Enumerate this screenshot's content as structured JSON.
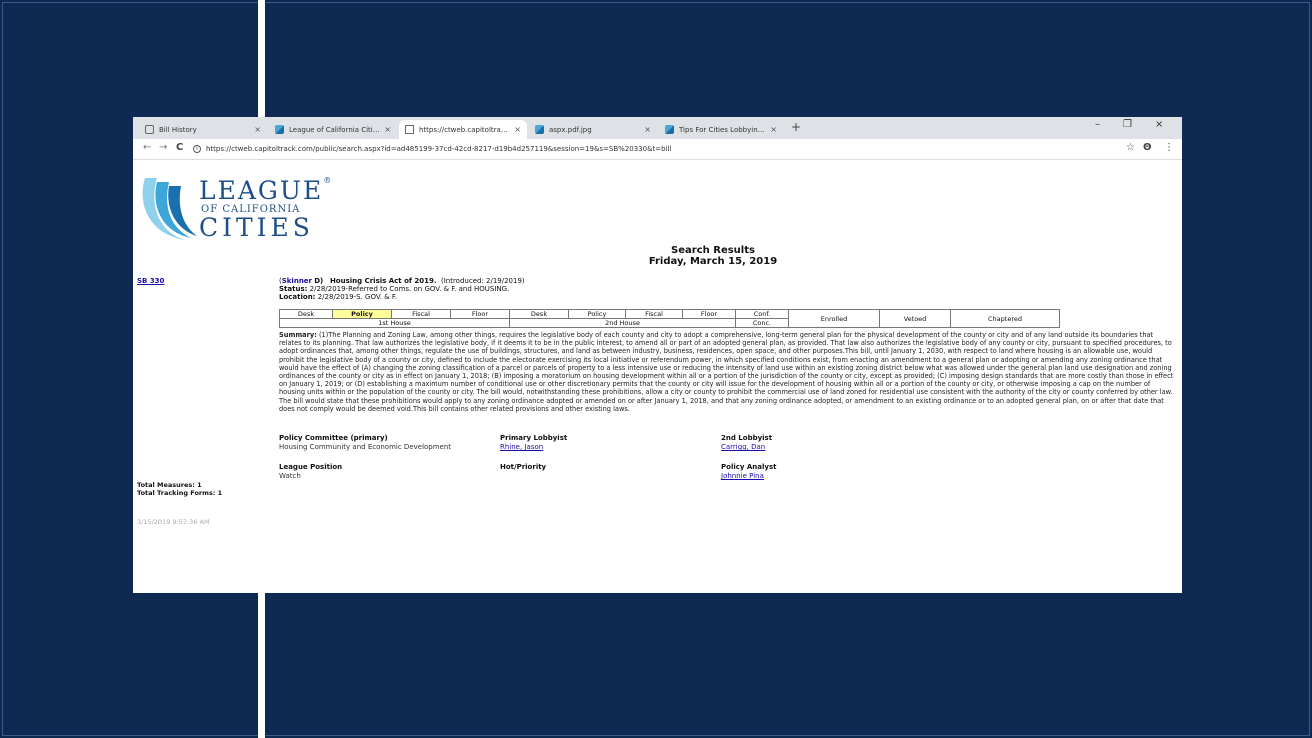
{
  "browser": {
    "tabs": [
      {
        "label": "Bill History",
        "icon": "history-icon"
      },
      {
        "label": "League of California Cities - Bill S",
        "icon": "league-favicon-icon"
      },
      {
        "label": "https://ctweb.capitoltrack.com/p",
        "icon": "page-icon"
      },
      {
        "label": "aspx.pdf.jpg",
        "icon": "league-favicon-icon"
      },
      {
        "label": "Tips For Cities Lobbying the State",
        "icon": "league-favicon-icon"
      }
    ],
    "new_tab": "+",
    "minimize": "–",
    "restore": "❐",
    "close": "×",
    "back": "←",
    "forward": "→",
    "reload": "C",
    "url": "https://ctweb.capitoltrack.com/public/search.aspx?id=ad485199-37cd-42cd-8217-d19b4d257119&session=19&s=SB%20330&t=bill",
    "bookmark": "☆",
    "profile": "Θ",
    "menu": "⋮"
  },
  "logo": {
    "line1": "LEAGUE",
    "reg": "®",
    "line2": "OF CALIFORNIA",
    "line3": "CITIES"
  },
  "results": {
    "title": "Search Results",
    "date": "Friday, March 15, 2019"
  },
  "bill": {
    "id": "SB 330",
    "author": "Skinner",
    "party": "D)",
    "open_paren": "(",
    "title": "Housing Crisis Act of 2019.",
    "introduced": "(Introduced: 2/19/2019)",
    "status_label": "Status:",
    "status": "2/28/2019-Referred to Coms. on GOV. & F. and HOUSING.",
    "location_label": "Location:",
    "location": "2/28/2019-S. GOV. & F."
  },
  "stages": {
    "first_house": [
      "Desk",
      "Policy",
      "Fiscal",
      "Floor"
    ],
    "second_house": [
      "Desk",
      "Policy",
      "Fiscal",
      "Floor"
    ],
    "conf": "Conf.",
    "conc": "Conc.",
    "enrolled": "Enrolled",
    "vetoed": "Vetoed",
    "chaptered": "Chaptered",
    "house1": "1st House",
    "house2": "2nd House"
  },
  "summary": {
    "label": "Summary:",
    "text": "(1)The Planning and Zoning Law, among other things, requires the legislative body of each county and city to adopt a comprehensive, long-term general plan for the physical development of the county or city and of any land outside its boundaries that relates to its planning. That law authorizes the legislative body, if it deems it to be in the public interest, to amend all or part of an adopted general plan, as provided. That law also authorizes the legislative body of any county or city, pursuant to specified procedures, to adopt ordinances that, among other things, regulate the use of buildings, structures, and land as between industry, business, residences, open space, and other purposes.This bill, until January 1, 2030, with respect to land where housing is an allowable use, would prohibit the legislative body of a county or city, defined to include the electorate exercising its local initiative or referendum power, in which specified conditions exist, from enacting an amendment to a general plan or adopting or amending any zoning ordinance that would have the effect of (A) changing the zoning classification of a parcel or parcels of property to a less intensive use or reducing the intensity of land use within an existing zoning district below what was allowed under the general plan land use designation and zoning ordinances of the county or city as in effect on January 1, 2018; (B) imposing a moratorium on housing development within all or a portion of the jurisdiction of the county or city, except as provided; (C) imposing design standards that are more costly than those in effect on January 1, 2019; or (D) establishing a maximum number of conditional use or other discretionary permits that the county or city will issue for the development of housing within all or a portion of the county or city, or otherwise imposing a cap on the number of housing units within or the population of the county or city. The bill would, notwithstanding these prohibitions, allow a city or county to prohibit the commercial use of land zoned for residential use consistent with the authority of the city or county conferred by other law. The bill would state that these prohibitions would apply to any zoning ordinance adopted or amended on or after January 1, 2018, and that any zoning ordinance adopted, or amendment to an existing ordinance or to an adopted general plan, on or after that date that does not comply would be deemed void.This bill contains other related provisions and other existing laws."
  },
  "details": {
    "policy_committee_label": "Policy Committee (primary)",
    "policy_committee": "Housing Community and Economic Development",
    "primary_lobbyist_label": "Primary Lobbyist",
    "primary_lobbyist": "Rhine, Jason",
    "second_lobbyist_label": "2nd Lobbyist",
    "second_lobbyist": "Carrigg, Dan",
    "league_position_label": "League Position",
    "league_position": "Watch",
    "hot_priority_label": "Hot/Priority",
    "policy_analyst_label": "Policy Analyst",
    "policy_analyst": "Johnnie Pina"
  },
  "totals": {
    "measures": "Total Measures: 1",
    "tracking": "Total Tracking Forms: 1"
  },
  "timestamp": "3/15/2019 9:57:36 AM",
  "colors": {
    "background": "#0f2a52",
    "highlight": "#ffff99",
    "link": "#1a0dab",
    "logo": "#1d4e89"
  }
}
